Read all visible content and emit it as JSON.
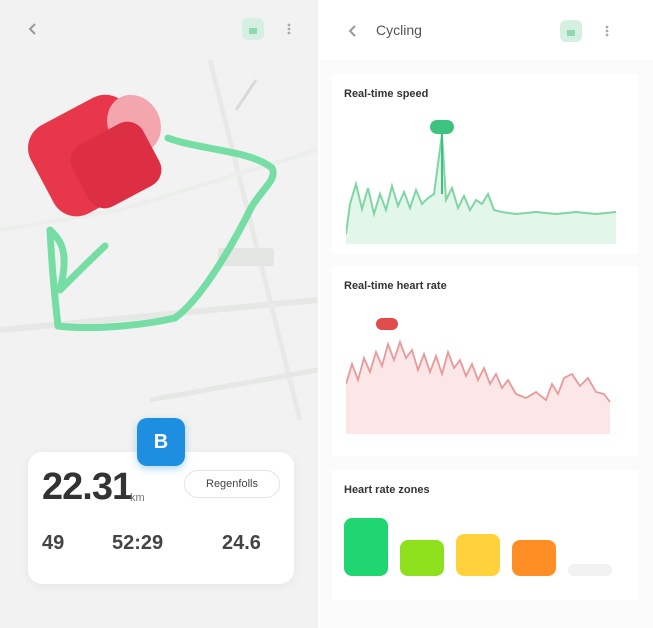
{
  "left": {
    "summary": {
      "distance": "22.31",
      "distance_unit": "km",
      "map_chip": "Regenfolls",
      "map_chip_sub": "",
      "stats": [
        {
          "value": "49",
          "label": ""
        },
        {
          "value": "52:29",
          "label": ""
        },
        {
          "value": "24.6",
          "label": ""
        }
      ]
    },
    "sport_badge": "B",
    "bottom_hint": ""
  },
  "right": {
    "title": "Cycling",
    "speed": {
      "title": "Real-time speed",
      "sub": "",
      "axis": [
        "",
        "",
        ""
      ],
      "colors": {
        "line": "#7fd6a4",
        "fill": "#e3f6ea",
        "peak": "#3cc47f"
      }
    },
    "heart": {
      "title": "Real-time heart rate",
      "note": "",
      "axis": [
        "",
        "",
        ""
      ],
      "bottom_axis": [
        "",
        "",
        "",
        "",
        ""
      ],
      "colors": {
        "line": "#e89a9a",
        "fill": "#fbe7e7",
        "peak": "#e04b4b"
      }
    },
    "zones": {
      "title": "Heart rate zones",
      "items": [
        {
          "label": "",
          "top": "",
          "color": "#1fd670",
          "level": 1.0
        },
        {
          "label": "",
          "top": "",
          "color": "#8ee01c",
          "level": 0.62
        },
        {
          "label": "",
          "top": "",
          "color": "#ffd23b",
          "level": 0.72
        },
        {
          "label": "",
          "top": "",
          "color": "#ff8f25",
          "level": 0.62
        },
        {
          "label": "",
          "top": "",
          "color": "#f2f2f2",
          "level": 0.2
        }
      ]
    }
  },
  "icons": {
    "back": "back-icon",
    "share": "share-icon",
    "more": "more-icon"
  }
}
